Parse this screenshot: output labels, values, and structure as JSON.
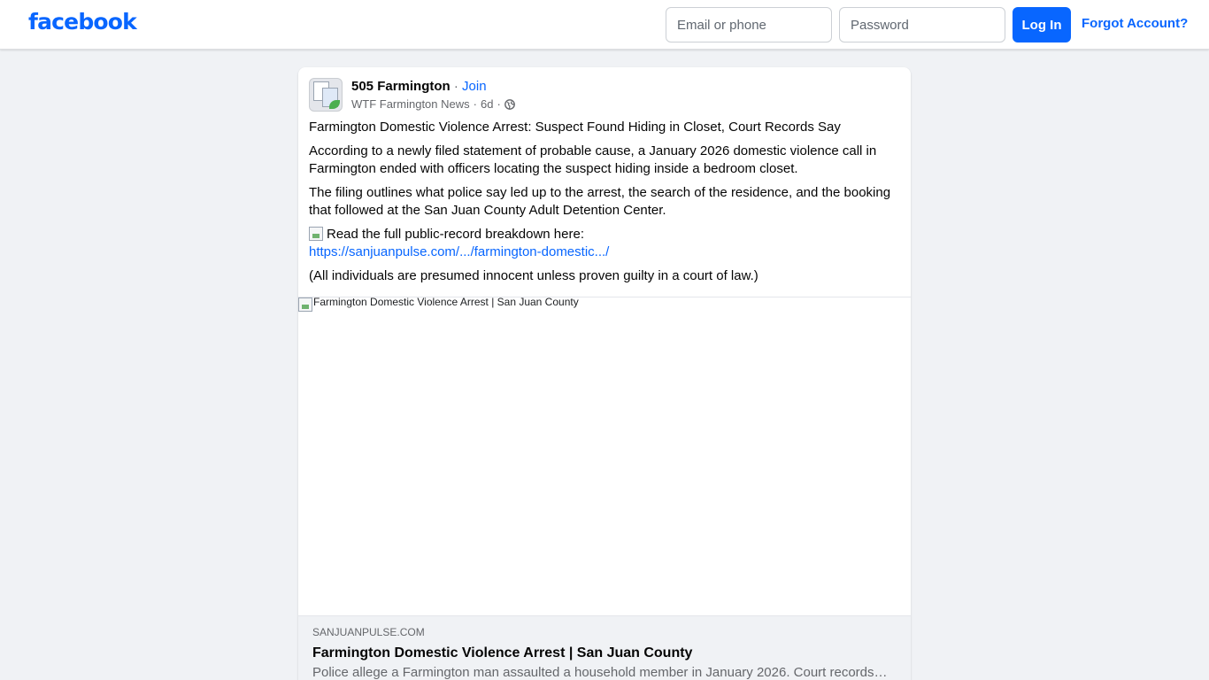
{
  "header": {
    "logo_text": "facebook",
    "email_placeholder": "Email or phone",
    "password_placeholder": "Password",
    "login_label": "Log In",
    "forgot_label": "Forgot Account?"
  },
  "post": {
    "group_name": "505 Farmington",
    "separator": "·",
    "join_label": "Join",
    "author": "WTF Farmington News",
    "meta_sep": "·",
    "age": "6d",
    "visibility_icon": "globe-icon",
    "paragraphs": [
      "Farmington Domestic Violence Arrest: Suspect Found Hiding in Closet, Court Records Say",
      "According to a newly filed statement of probable cause, a January 2026 domestic violence call in Farmington ended with officers locating the suspect hiding inside a bedroom closet.",
      "The filing outlines what police say led up to the arrest, the search of the residence, and the booking that followed at the San Juan County Adult Detention Center."
    ],
    "read_more_text": "Read the full public-record breakdown here:",
    "link_text": "https://sanjuanpulse.com/.../farmington-domestic.../",
    "disclaimer": "(All individuals are presumed innocent unless proven guilty in a court of law.)",
    "image_alt": "Farmington Domestic Violence Arrest | San Juan County",
    "preview": {
      "domain": "SANJUANPULSE.COM",
      "title": "Farmington Domestic Violence Arrest | San Juan County",
      "description": "Police allege a Farmington man assaulted a household member in January 2026. Court records d..."
    }
  },
  "colors": {
    "brand": "#0866ff",
    "page_bg": "#f0f2f5",
    "secondary_text": "#65676b"
  }
}
